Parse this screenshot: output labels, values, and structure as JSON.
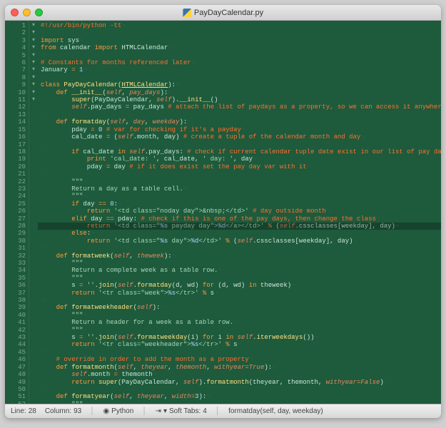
{
  "window": {
    "title": "PayDayCalendar.py"
  },
  "code_lines": [
    {
      "n": 1,
      "fold": "",
      "html": "<span class='cm'>#!/usr/bin/python -tt</span><span class='eol'>¬</span>"
    },
    {
      "n": 2,
      "fold": "",
      "html": "<span class='eol'>¬</span>"
    },
    {
      "n": 3,
      "fold": "",
      "html": "<span class='kw'>import</span> sys<span class='eol'>¬</span>"
    },
    {
      "n": 4,
      "fold": "",
      "html": "<span class='kw'>from</span> calendar <span class='kw'>import</span> HTMLCalendar<span class='eol'>¬</span>"
    },
    {
      "n": 5,
      "fold": "",
      "html": "<span class='eol'>¬</span>"
    },
    {
      "n": 6,
      "fold": "",
      "html": "<span class='cm'># Constants for months referenced later</span><span class='eol'>¬</span>"
    },
    {
      "n": 7,
      "fold": "",
      "html": "January <span class='kw'>=</span> <span class='num'>1</span><span class='eol'>¬</span>"
    },
    {
      "n": 8,
      "fold": "",
      "html": "<span class='eol'>¬</span>"
    },
    {
      "n": 9,
      "fold": "▾",
      "html": "<span class='kw'>class</span> <span class='fn'>PayDayCalendar</span>(<span class='cls'>HTMLCalendar</span>):<span class='eol'>¬</span>"
    },
    {
      "n": 10,
      "fold": "▾",
      "html": "    <span class='kw'>def</span> <span class='fn'>__init__</span>(<span class='sl'>self</span>, <span class='sl'>pay_days</span>):<span class='eol'>¬</span>"
    },
    {
      "n": 11,
      "fold": "",
      "html": "        <span class='fn'>super</span>(PayDayCalendar, <span class='sl'>self</span>).<span class='fn'>__init__</span>()<span class='eol'>¬</span>"
    },
    {
      "n": 12,
      "fold": "",
      "html": "        <span class='sl'>self</span>.pay_days <span class='kw'>=</span> pay_days <span class='cm'># attach the list of paydays as a property, so we can access it anywhere</span><span class='eol'>¬</span>"
    },
    {
      "n": 13,
      "fold": "",
      "html": "<span class='eol'>¬</span>"
    },
    {
      "n": 14,
      "fold": "▾",
      "html": "    <span class='kw'>def</span> <span class='fn'>formatday</span>(<span class='sl'>self</span>, <span class='sl'>day</span>, <span class='sl'>weekday</span>):<span class='eol'>¬</span>"
    },
    {
      "n": 15,
      "fold": "",
      "html": "        pday <span class='kw'>=</span> <span class='num'>0</span> <span class='cm'># var for checking if it's a payday</span><span class='eol'>¬</span>"
    },
    {
      "n": 16,
      "fold": "",
      "html": "        cal_date <span class='kw'>=</span> (<span class='sl'>self</span>.month, day) <span class='cm'># create a tuple of the calendar month and day</span><span class='eol'>¬</span>"
    },
    {
      "n": 17,
      "fold": "",
      "html": "<span class='eol'>¬</span>"
    },
    {
      "n": 18,
      "fold": "▾",
      "html": "        <span class='kw'>if</span> cal_date <span class='kw'>in</span> <span class='sl'>self</span>.pay_days: <span class='cm'># check if current calendar tuple date exist in our list of pay days</span><span class='eol'>¬</span>"
    },
    {
      "n": 19,
      "fold": "",
      "html": "            <span class='kw'>print</span> <span class='str'>'cal_date: '</span>, cal_date, <span class='str'>' day: '</span>, day<span class='eol'>¬</span>"
    },
    {
      "n": 20,
      "fold": "",
      "html": "            pday <span class='kw'>=</span> day <span class='cm'># if it does exist set the pay day var with it</span><span class='eol'>¬</span>"
    },
    {
      "n": 21,
      "fold": "",
      "html": "<span class='eol'>¬</span>"
    },
    {
      "n": 22,
      "fold": "",
      "html": "        <span class='str'>\"\"\"</span><span class='eol'>¬</span>"
    },
    {
      "n": 23,
      "fold": "",
      "html": "<span class='str'>        Return a day as a table cell.</span><span class='eol'>¬</span>"
    },
    {
      "n": 24,
      "fold": "",
      "html": "<span class='str'>        \"\"\"</span><span class='eol'>¬</span>"
    },
    {
      "n": 25,
      "fold": "▾",
      "html": "        <span class='kw'>if</span> day <span class='kw'>==</span> <span class='num'>0</span>:<span class='eol'>¬</span>"
    },
    {
      "n": 26,
      "fold": "",
      "html": "            <span class='kw'>return</span> <span class='str'>'&lt;td class=\"noday day\"&gt;&amp;nbsp;&lt;/td&gt;'</span> <span class='cm'># day outside month</span><span class='eol'>¬</span>"
    },
    {
      "n": 27,
      "fold": "▾",
      "html": "        <span class='kw'>elif</span> day <span class='kw'>==</span> pday: <span class='cm'># check if this is one of the pay days, then change the class</span><span class='eol'>¬</span>"
    },
    {
      "n": 28,
      "fold": "",
      "html": "            <span class='kw'>return</span> <span class='str'>'&lt;td class=\"</span><span class='num'>%s</span><span class='str'> payday day\"&gt;</span><span class='num'>%d</span><span class='str'>&lt;/a&gt;&lt;/td&gt;'</span> <span class='kw'>%</span> (<span class='sl'>self</span>.cssclasses[weekday], day)<span class='eol'>¬</span>"
    },
    {
      "n": 29,
      "fold": "▾",
      "html": "        <span class='kw'>else</span>:<span class='eol'>¬</span>"
    },
    {
      "n": 30,
      "fold": "",
      "html": "            <span class='kw'>return</span> <span class='str'>'&lt;td class=\"</span><span class='num'>%s</span><span class='str'> day\"&gt;</span><span class='num'>%d</span><span class='str'>&lt;/td&gt;'</span> <span class='kw'>%</span> (<span class='sl'>self</span>.cssclasses[weekday], day)<span class='eol'>¬</span>"
    },
    {
      "n": 31,
      "fold": "",
      "html": "<span class='eol'>¬</span>"
    },
    {
      "n": 32,
      "fold": "▾",
      "html": "    <span class='kw'>def</span> <span class='fn'>formatweek</span>(<span class='sl'>self</span>, <span class='sl'>theweek</span>):<span class='eol'>¬</span>"
    },
    {
      "n": 33,
      "fold": "",
      "html": "        <span class='str'>\"\"\"</span><span class='eol'>¬</span>"
    },
    {
      "n": 34,
      "fold": "",
      "html": "<span class='str'>        Return a complete week as a table row.</span><span class='eol'>¬</span>"
    },
    {
      "n": 35,
      "fold": "",
      "html": "<span class='str'>        \"\"\"</span><span class='eol'>¬</span>"
    },
    {
      "n": 36,
      "fold": "",
      "html": "        s <span class='kw'>=</span> <span class='str'>''</span>.<span class='fn'>join</span>(<span class='sl'>self</span>.<span class='fn'>formatday</span>(d, wd) <span class='kw'>for</span> (d, wd) <span class='kw'>in</span> theweek)<span class='eol'>¬</span>"
    },
    {
      "n": 37,
      "fold": "",
      "html": "        <span class='kw'>return</span> <span class='str'>'&lt;tr class=\"week\"&gt;</span><span class='num'>%s</span><span class='str'>&lt;/tr&gt;'</span> <span class='kw'>%</span> s<span class='eol'>¬</span>"
    },
    {
      "n": 38,
      "fold": "",
      "html": "<span class='eol'>¬</span>"
    },
    {
      "n": 39,
      "fold": "▾",
      "html": "    <span class='kw'>def</span> <span class='fn'>formatweekheader</span>(<span class='sl'>self</span>):<span class='eol'>¬</span>"
    },
    {
      "n": 40,
      "fold": "",
      "html": "        <span class='str'>\"\"\"</span><span class='eol'>¬</span>"
    },
    {
      "n": 41,
      "fold": "",
      "html": "<span class='str'>        Return a header for a week as a table row.</span><span class='eol'>¬</span>"
    },
    {
      "n": 42,
      "fold": "",
      "html": "<span class='str'>        \"\"\"</span><span class='eol'>¬</span>"
    },
    {
      "n": 43,
      "fold": "",
      "html": "        s <span class='kw'>=</span> <span class='str'>''</span>.<span class='fn'>join</span>(<span class='sl'>self</span>.<span class='fn'>formatweekday</span>(i) <span class='kw'>for</span> i <span class='kw'>in</span> <span class='sl'>self</span>.<span class='fn'>iterweekdays</span>())<span class='eol'>¬</span>"
    },
    {
      "n": 44,
      "fold": "",
      "html": "        <span class='kw'>return</span> <span class='str'>'&lt;tr class=\"weekheader\"&gt;</span><span class='num'>%s</span><span class='str'>&lt;/tr&gt;'</span> <span class='kw'>%</span> s<span class='eol'>¬</span>"
    },
    {
      "n": 45,
      "fold": "",
      "html": "<span class='eol'>¬</span>"
    },
    {
      "n": 46,
      "fold": "",
      "html": "    <span class='cm'># override in order to add the month as a property</span><span class='eol'>¬</span>"
    },
    {
      "n": 47,
      "fold": "▾",
      "html": "    <span class='kw'>def</span> <span class='fn'>formatmonth</span>(<span class='sl'>self</span>, <span class='sl'>theyear</span>, <span class='sl'>themonth</span>, <span class='sl'>withyear</span><span class='kw'>=</span><span class='sl'>True</span>):<span class='eol'>¬</span>"
    },
    {
      "n": 48,
      "fold": "",
      "html": "        <span class='sl'>self</span>.month <span class='kw'>=</span> themonth<span class='eol'>¬</span>"
    },
    {
      "n": 49,
      "fold": "",
      "html": "        <span class='kw'>return</span> <span class='fn'>super</span>(PayDayCalendar, <span class='sl'>self</span>).<span class='fn'>formatmonth</span>(theyear, themonth, <span class='sl'>withyear</span><span class='kw'>=</span><span class='sl'>False</span>)<span class='eol'>¬</span>"
    },
    {
      "n": 50,
      "fold": "",
      "html": "<span class='eol'>¬</span>"
    },
    {
      "n": 51,
      "fold": "▾",
      "html": "    <span class='kw'>def</span> <span class='fn'>formatyear</span>(<span class='sl'>self</span>, <span class='sl'>theyear</span>, <span class='sl'>width</span><span class='kw'>=</span><span class='num'>3</span>):<span class='eol'>¬</span>"
    },
    {
      "n": 52,
      "fold": "",
      "html": "        <span class='str'>\"\"\"</span><span class='eol'>¬</span>"
    }
  ],
  "highlight_line": 28,
  "statusbar": {
    "line_label": "Line:",
    "line_value": "28",
    "col_label": "Column:",
    "col_value": "93",
    "language": "Python",
    "softtabs_label": "Soft Tabs:",
    "softtabs_value": "4",
    "symbol": "formatday(self, day, weekday)"
  }
}
